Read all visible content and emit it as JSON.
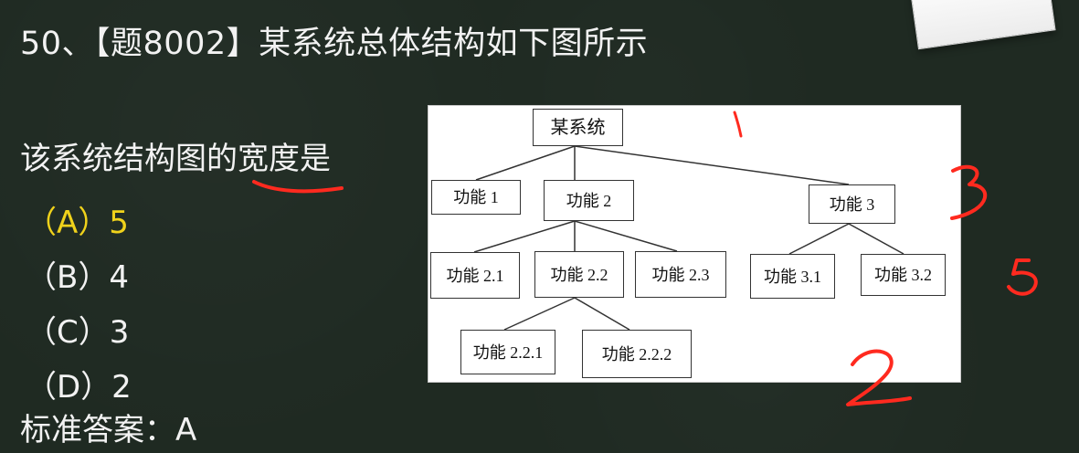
{
  "header": {
    "title": "50、【题8002】某系统总体结构如下图所示"
  },
  "question": {
    "text": "该系统结构图的宽度是"
  },
  "options": [
    {
      "label": "（A）5"
    },
    {
      "label": "（B）4"
    },
    {
      "label": "（C）3"
    },
    {
      "label": "（D）2"
    }
  ],
  "answer": {
    "text": "标准答案：A"
  },
  "diagram": {
    "nodes": [
      {
        "label": "某系统"
      },
      {
        "label": "功能 1"
      },
      {
        "label": "功能 2"
      },
      {
        "label": "功能 3"
      },
      {
        "label": "功能 2.1"
      },
      {
        "label": "功能 2.2"
      },
      {
        "label": "功能 2.3"
      },
      {
        "label": "功能 3.1"
      },
      {
        "label": "功能 3.2"
      },
      {
        "label": "功能 2.2.1"
      },
      {
        "label": "功能 2.2.2"
      }
    ]
  },
  "colors": {
    "board": "#1f2a22",
    "highlight": "#f0d21b",
    "annotation": "#ff2a1f"
  },
  "icons": {
    "paper_note": "sticky-note-icon"
  }
}
